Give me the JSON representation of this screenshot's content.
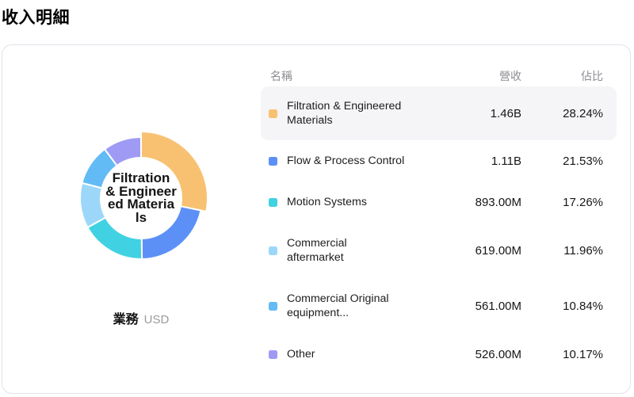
{
  "page_title": "收入明細",
  "table": {
    "headers": {
      "name": "名稱",
      "revenue": "營收",
      "share": "佔比"
    },
    "rows": [
      {
        "name": "Filtration & Engineered\nMaterials",
        "revenue": "1.46B",
        "share": "28.24%",
        "color": "#F8C172",
        "highlighted": true
      },
      {
        "name": "Flow & Process Control",
        "revenue": "1.11B",
        "share": "21.53%",
        "color": "#5C90F7",
        "highlighted": false
      },
      {
        "name": "Motion Systems",
        "revenue": "893.00M",
        "share": "17.26%",
        "color": "#40D2E2",
        "highlighted": false
      },
      {
        "name": "Commercial\naftermarket",
        "revenue": "619.00M",
        "share": "11.96%",
        "color": "#9CD7F9",
        "highlighted": false
      },
      {
        "name": "Commercial Original\nequipment...",
        "revenue": "561.00M",
        "share": "10.84%",
        "color": "#62BBF5",
        "highlighted": false
      },
      {
        "name": "Other",
        "revenue": "526.00M",
        "share": "10.17%",
        "color": "#9F9BF4",
        "highlighted": false
      }
    ]
  },
  "chart": {
    "center_label": "Filtration\n& Engineer\ned Materia\nls",
    "dimension_label": "業務",
    "unit": "USD"
  },
  "chart_data": {
    "type": "pie",
    "title": "收入明細",
    "donut": true,
    "start_angle": "top",
    "direction": "clockwise",
    "unit": "USD",
    "dimension_label": "業務",
    "selected": "Filtration & Engineered Materials",
    "series": [
      {
        "name": "Filtration & Engineered Materials",
        "value": 1460000000,
        "value_label": "1.46B",
        "percent": 28.24,
        "color": "#F8C172"
      },
      {
        "name": "Flow & Process Control",
        "value": 1110000000,
        "value_label": "1.11B",
        "percent": 21.53,
        "color": "#5C90F7"
      },
      {
        "name": "Motion Systems",
        "value": 893000000,
        "value_label": "893.00M",
        "percent": 17.26,
        "color": "#40D2E2"
      },
      {
        "name": "Commercial aftermarket",
        "value": 619000000,
        "value_label": "619.00M",
        "percent": 11.96,
        "color": "#9CD7F9"
      },
      {
        "name": "Commercial Original equipment",
        "value": 561000000,
        "value_label": "561.00M",
        "percent": 10.84,
        "color": "#62BBF5"
      },
      {
        "name": "Other",
        "value": 526000000,
        "value_label": "526.00M",
        "percent": 10.17,
        "color": "#9F9BF4"
      }
    ]
  }
}
